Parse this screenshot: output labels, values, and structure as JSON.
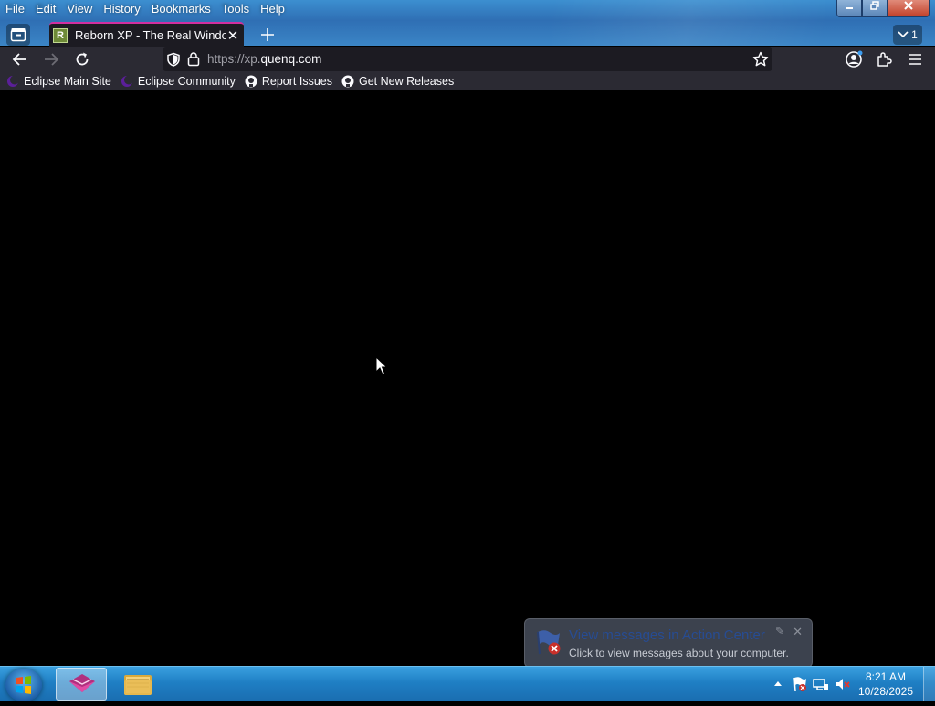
{
  "menu": [
    "File",
    "Edit",
    "View",
    "History",
    "Bookmarks",
    "Tools",
    "Help"
  ],
  "tab": {
    "title": "Reborn XP - The Real Windows",
    "favicon_letter": "R"
  },
  "tab_count": "1",
  "url": {
    "prefix": "https://xp.",
    "domain": "quenq.com"
  },
  "bookmarks": [
    {
      "label": "Eclipse Main Site",
      "icon": "eclipse-icon"
    },
    {
      "label": "Eclipse Community",
      "icon": "eclipse-icon"
    },
    {
      "label": "Report Issues",
      "icon": "github-icon"
    },
    {
      "label": "Get New Releases",
      "icon": "github-icon"
    }
  ],
  "toast": {
    "title": "View messages in Action Center",
    "subtitle": "Click to view messages about your computer."
  },
  "clock": {
    "time": "8:21 AM",
    "date": "10/28/2025"
  },
  "colors": {
    "tab_accent": "#d22fa0",
    "toolbar": "#2b2a33",
    "taskbar": "#1f7fc4"
  }
}
